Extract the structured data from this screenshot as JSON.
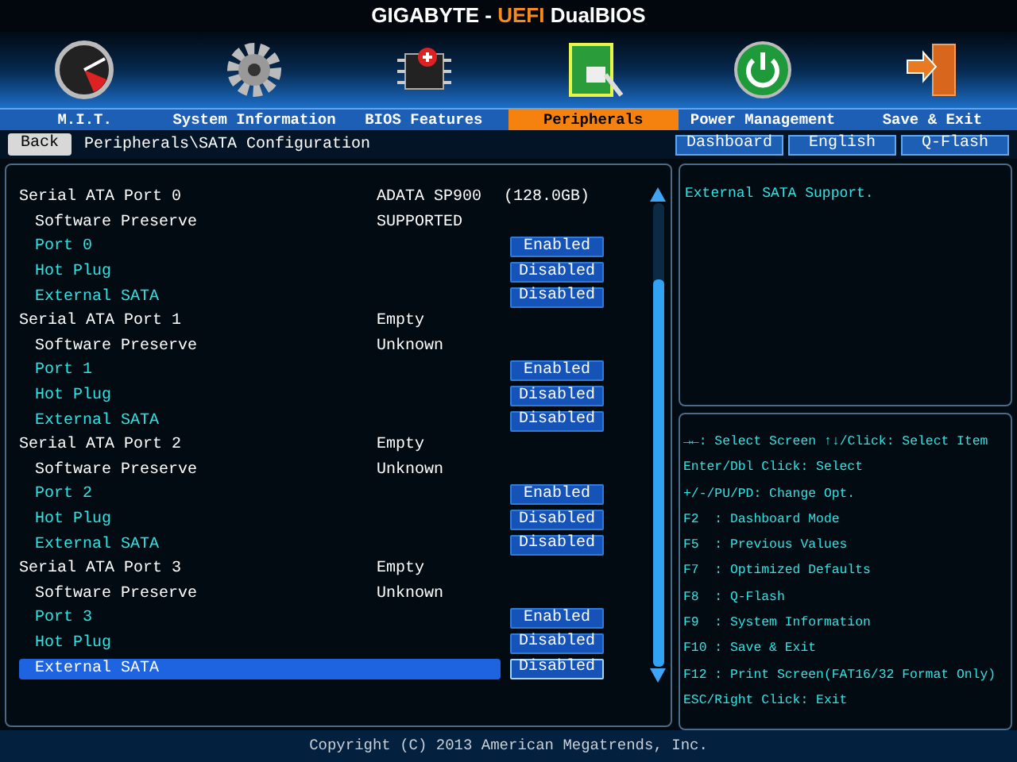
{
  "title": {
    "brand": "GIGABYTE - ",
    "accent": "UEFI",
    "rest": " DualBIOS"
  },
  "tabs": [
    {
      "label": "M.I.T.",
      "selected": false
    },
    {
      "label": "System Information",
      "selected": false
    },
    {
      "label": "BIOS Features",
      "selected": false
    },
    {
      "label": "Peripherals",
      "selected": true
    },
    {
      "label": "Power Management",
      "selected": false
    },
    {
      "label": "Save & Exit",
      "selected": false
    }
  ],
  "back_button": "Back",
  "breadcrumb": "Peripherals\\SATA Configuration",
  "top_buttons": [
    "Dashboard",
    "English",
    "Q-Flash"
  ],
  "rows": [
    {
      "kind": "header",
      "label": "Serial ATA Port 0",
      "value": "ADATA SP900",
      "value2": "(128.0GB)"
    },
    {
      "kind": "info",
      "label": "Software Preserve",
      "value": "SUPPORTED"
    },
    {
      "kind": "option",
      "label": "Port 0",
      "value": "Enabled",
      "selected": false
    },
    {
      "kind": "option",
      "label": "Hot Plug",
      "value": "Disabled",
      "selected": false
    },
    {
      "kind": "option",
      "label": "External SATA",
      "value": "Disabled",
      "selected": false
    },
    {
      "kind": "header",
      "label": "Serial ATA Port 1",
      "value": "Empty"
    },
    {
      "kind": "info",
      "label": "Software Preserve",
      "value": "Unknown"
    },
    {
      "kind": "option",
      "label": "Port 1",
      "value": "Enabled",
      "selected": false
    },
    {
      "kind": "option",
      "label": "Hot Plug",
      "value": "Disabled",
      "selected": false
    },
    {
      "kind": "option",
      "label": "External SATA",
      "value": "Disabled",
      "selected": false
    },
    {
      "kind": "header",
      "label": "Serial ATA Port 2",
      "value": "Empty"
    },
    {
      "kind": "info",
      "label": "Software Preserve",
      "value": "Unknown"
    },
    {
      "kind": "option",
      "label": "Port 2",
      "value": "Enabled",
      "selected": false
    },
    {
      "kind": "option",
      "label": "Hot Plug",
      "value": "Disabled",
      "selected": false
    },
    {
      "kind": "option",
      "label": "External SATA",
      "value": "Disabled",
      "selected": false
    },
    {
      "kind": "header",
      "label": "Serial ATA Port 3",
      "value": "Empty"
    },
    {
      "kind": "info",
      "label": "Software Preserve",
      "value": "Unknown"
    },
    {
      "kind": "option",
      "label": "Port 3",
      "value": "Enabled",
      "selected": false
    },
    {
      "kind": "option",
      "label": "Hot Plug",
      "value": "Disabled",
      "selected": false
    },
    {
      "kind": "option",
      "label": "External SATA",
      "value": "Disabled",
      "selected": true
    }
  ],
  "description": "External SATA Support.",
  "help": [
    [
      "→←: Select Screen",
      "↑↓/Click: Select Item"
    ],
    [
      "Enter/Dbl Click: Select"
    ],
    [
      "+/-/PU/PD: Change Opt."
    ],
    [
      "F2  : Dashboard Mode"
    ],
    [
      "F5  : Previous Values"
    ],
    [
      "F7  : Optimized Defaults"
    ],
    [
      "F8  : Q-Flash"
    ],
    [
      "F9  : System Information"
    ],
    [
      "F10 : Save & Exit"
    ],
    [
      "F12 : Print Screen(FAT16/32 Format Only)"
    ],
    [
      "ESC/Right Click: Exit"
    ]
  ],
  "copyright": "Copyright (C) 2013 American Megatrends, Inc."
}
